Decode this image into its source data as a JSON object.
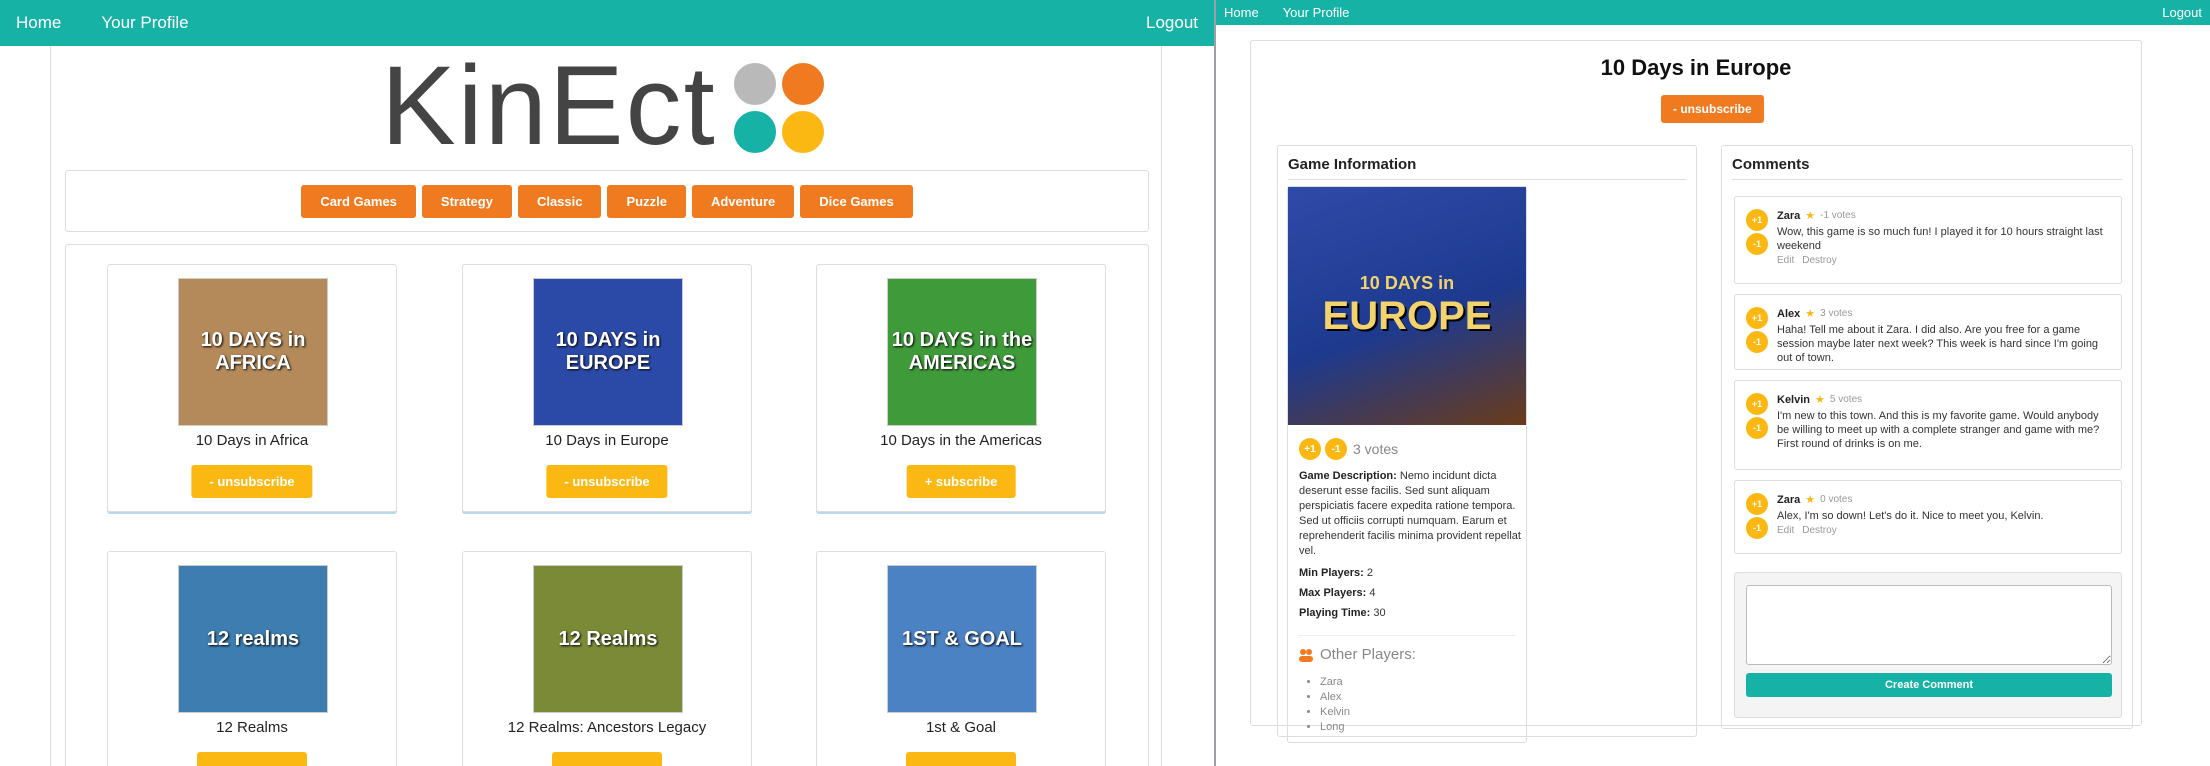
{
  "left": {
    "nav": {
      "home": "Home",
      "profile": "Your Profile",
      "logout": "Logout"
    },
    "logo": {
      "text": "KinEct",
      "dot_colors": [
        "#b9b9b9",
        "#f07a1f",
        "#17b2a6",
        "#fbb813"
      ]
    },
    "categories": [
      "Card Games",
      "Strategy",
      "Classic",
      "Puzzle",
      "Adventure",
      "Dice Games"
    ],
    "games": [
      {
        "title": "10 Days in Africa",
        "cover_text": "10 DAYS in AFRICA",
        "cover_color": "#b48a5a",
        "button": "- unsubscribe"
      },
      {
        "title": "10 Days in Europe",
        "cover_text": "10 DAYS in EUROPE",
        "cover_color": "#2b4aa8",
        "button": "- unsubscribe"
      },
      {
        "title": "10 Days in the Americas",
        "cover_text": "10 DAYS in the AMERICAS",
        "cover_color": "#3f9b3a",
        "button": "+ subscribe"
      },
      {
        "title": "12 Realms",
        "cover_text": "12 realms",
        "cover_color": "#3d7db0",
        "button": ""
      },
      {
        "title": "12 Realms: Ancestors Legacy",
        "cover_text": "12 Realms",
        "cover_color": "#7a8a36",
        "button": ""
      },
      {
        "title": "1st & Goal",
        "cover_text": "1ST & GOAL",
        "cover_color": "#4b82c4",
        "button": ""
      }
    ]
  },
  "right": {
    "nav": {
      "home": "Home",
      "profile": "Your Profile",
      "logout": "Logout"
    },
    "title": "10 Days in Europe",
    "unsubscribe": "- unsubscribe",
    "game_info": {
      "heading": "Game Information",
      "cover_line1": "10 DAYS in",
      "cover_line2": "EUROPE",
      "upvote": "+1",
      "downvote": "-1",
      "votes": "3 votes",
      "description_label": "Game Description:",
      "description": " Nemo incidunt dicta deserunt esse facilis. Sed sunt aliquam perspiciatis facere expedita ratione tempora. Sed ut officiis corrupti numquam. Earum et reprehenderit facilis minima provident repellat vel.",
      "min_players_label": "Min Players:",
      "min_players": " 2",
      "max_players_label": "Max Players:",
      "max_players": " 4",
      "playing_time_label": "Playing Time:",
      "playing_time": " 30",
      "other_players_heading": "Other Players:",
      "other_players": [
        "Zara",
        "Alex",
        "Kelvin",
        "Long"
      ]
    },
    "comments": {
      "heading": "Comments",
      "items": [
        {
          "author": "Zara",
          "votes": "-1 votes",
          "body": "Wow, this game is so much fun! I played it for 10 hours straight last weekend",
          "edit": "Edit",
          "destroy": "Destroy"
        },
        {
          "author": "Alex",
          "votes": "3 votes",
          "body": "Haha! Tell me about it Zara. I did also. Are you free for a game session maybe later next week? This week is hard since I'm going out of town.",
          "edit": "",
          "destroy": ""
        },
        {
          "author": "Kelvin",
          "votes": "5 votes",
          "body": "I'm new to this town. And this is my favorite game. Would anybody be willing to meet up with a complete stranger and game with me? First round of drinks is on me.",
          "edit": "",
          "destroy": ""
        },
        {
          "author": "Zara",
          "votes": "0 votes",
          "body": "Alex, I'm so down! Let's do it. Nice to meet you, Kelvin.",
          "edit": "Edit",
          "destroy": "Destroy"
        }
      ],
      "create_button": "Create Comment"
    }
  }
}
